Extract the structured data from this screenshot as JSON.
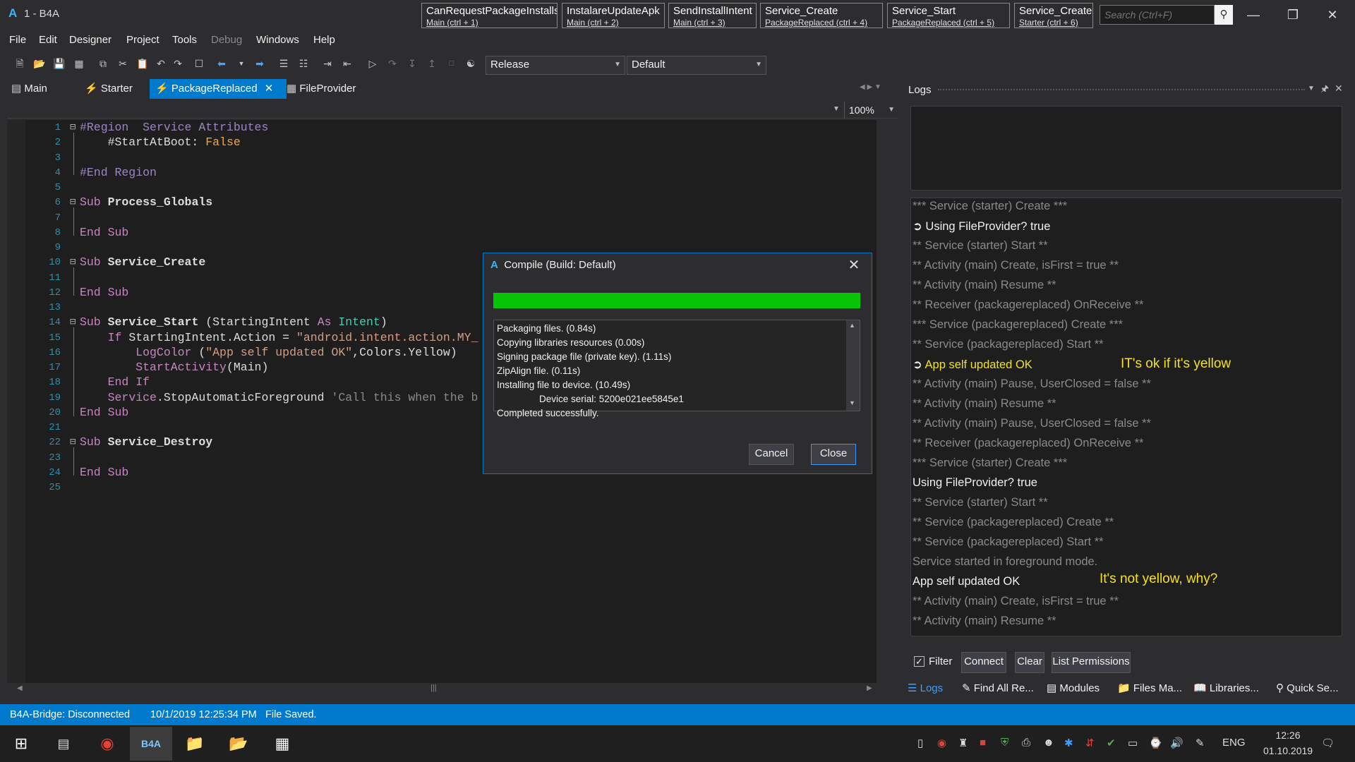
{
  "window": {
    "title": "1 - B4A",
    "logo": "A"
  },
  "quick_buttons": [
    {
      "title": "CanRequestPackageInstalls",
      "sub": "Main  (ctrl + 1)"
    },
    {
      "title": "InstalareUpdateApk",
      "sub": "Main  (ctrl + 2)"
    },
    {
      "title": "SendInstallIntent",
      "sub": "Main  (ctrl + 3)"
    },
    {
      "title": "Service_Create",
      "sub": "PackageReplaced  (ctrl + 4)"
    },
    {
      "title": "Service_Start",
      "sub": "PackageReplaced  (ctrl + 5)"
    },
    {
      "title": "Service_Create",
      "sub": "Starter  (ctrl + 6)"
    }
  ],
  "search": {
    "placeholder": "Search (Ctrl+F)"
  },
  "menu": [
    "File",
    "Edit",
    "Designer",
    "Project",
    "Tools",
    "Debug",
    "Windows",
    "Help"
  ],
  "toolbar": {
    "build_mode": "Release",
    "build_config": "Default"
  },
  "doc_tabs": [
    "Main",
    "Starter",
    "PackageReplaced",
    "FileProvider"
  ],
  "zoom": "100%",
  "code": {
    "line_numbers": [
      "1",
      "2",
      "3",
      "4",
      "5",
      "6",
      "7",
      "8",
      "9",
      "10",
      "11",
      "12",
      "13",
      "14",
      "15",
      "16",
      "17",
      "18",
      "19",
      "20",
      "21",
      "22",
      "23",
      "24",
      "25"
    ]
  },
  "dialog": {
    "title": "Compile (Build: Default)",
    "progress_fraction": 1.0,
    "log": [
      "Packaging files.   (0.84s)",
      "Copying libraries resources    (0.00s)",
      "Signing package file (private key).    (1.11s)",
      "ZipAlign file.    (0.11s)",
      "Installing file to device.    (10.49s)",
      "Device serial: 5200e021ee5845e1",
      "Completed successfully."
    ],
    "cancel": "Cancel",
    "close": "Close"
  },
  "logs_panel": {
    "title": "Logs",
    "entries": [
      {
        "text": "*** Service (starter) Create ***",
        "color": "gray"
      },
      {
        "text": "Using FileProvider? true",
        "color": "white"
      },
      {
        "text": "** Service (starter) Start **",
        "color": "gray"
      },
      {
        "text": "** Activity (main) Create, isFirst = true **",
        "color": "gray"
      },
      {
        "text": "** Activity (main) Resume **",
        "color": "gray"
      },
      {
        "text": "** Receiver (packagereplaced) OnReceive **",
        "color": "gray"
      },
      {
        "text": "*** Service (packagereplaced) Create ***",
        "color": "gray"
      },
      {
        "text": "** Service (packagereplaced) Start **",
        "color": "gray"
      },
      {
        "text": "App self updated OK",
        "color": "yellow"
      },
      {
        "text": "** Activity (main) Pause, UserClosed = false **",
        "color": "gray"
      },
      {
        "text": "** Activity (main) Resume **",
        "color": "gray"
      },
      {
        "text": "** Activity (main) Pause, UserClosed = false **",
        "color": "gray"
      },
      {
        "text": "** Receiver (packagereplaced) OnReceive **",
        "color": "gray"
      },
      {
        "text": "*** Service (starter) Create ***",
        "color": "gray"
      },
      {
        "text": "Using FileProvider? true",
        "color": "white"
      },
      {
        "text": "** Service (starter) Start **",
        "color": "gray"
      },
      {
        "text": "** Service (packagereplaced) Create **",
        "color": "gray"
      },
      {
        "text": "** Service (packagereplaced) Start **",
        "color": "gray"
      },
      {
        "text": "Service started in foreground mode.",
        "color": "gray"
      },
      {
        "text": "App self updated OK",
        "color": "white"
      },
      {
        "text": "** Activity (main) Create, isFirst = true **",
        "color": "gray"
      },
      {
        "text": "** Activity (main) Resume **",
        "color": "gray"
      }
    ],
    "annotation_1": "IT's ok if it's yellow",
    "annotation_2": "It's not yellow, why?",
    "filter_label": "Filter",
    "buttons": [
      "Connect",
      "Clear",
      "List Permissions"
    ],
    "bottom_tabs": [
      "Logs",
      "Find All Re...",
      "Modules",
      "Files Ma...",
      "Libraries...",
      "Quick Se..."
    ]
  },
  "status": {
    "bridge": "B4A-Bridge: Disconnected",
    "time": "10/1/2019 12:25:34 PM",
    "message": "File Saved."
  },
  "taskbar": {
    "lang": "ENG",
    "time": "12:26",
    "date": "01.10.2019"
  },
  "colors": {
    "accent": "#007acc",
    "progress": "#06c406",
    "highlight": "#f5e21a"
  }
}
